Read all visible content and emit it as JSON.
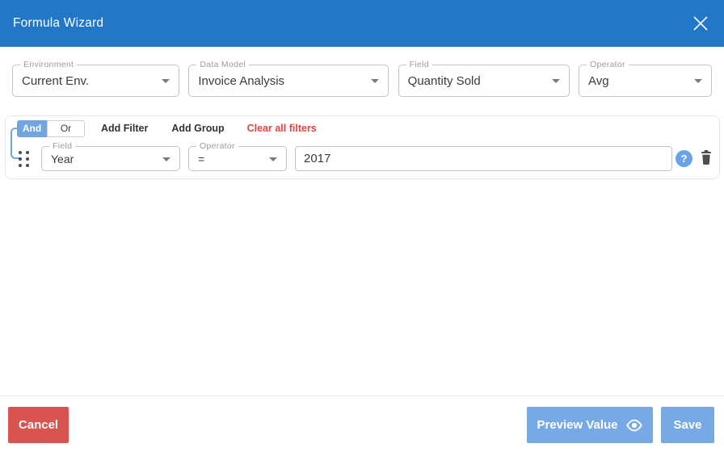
{
  "header": {
    "title": "Formula Wizard"
  },
  "selectors": {
    "environment": {
      "label": "Environment",
      "value": "Current Env."
    },
    "data_model": {
      "label": "Data Model",
      "value": "Invoice Analysis"
    },
    "field": {
      "label": "Field",
      "value": "Quantity Sold"
    },
    "operator": {
      "label": "Operator",
      "value": "Avg"
    }
  },
  "filters": {
    "and_label": "And",
    "or_label": "Or",
    "selected_logic": "And",
    "add_filter": "Add Filter",
    "add_group": "Add Group",
    "clear_all": "Clear all filters",
    "row": {
      "field_label": "Field",
      "field_value": "Year",
      "operator_label": "Operator",
      "operator_value": "=",
      "value": "2017",
      "help_glyph": "?"
    }
  },
  "footer": {
    "cancel": "Cancel",
    "preview": "Preview Value",
    "save": "Save"
  },
  "colors": {
    "header_bg": "#2277c8",
    "button_blue": "#77a9e6",
    "toggle_blue": "#70a5e0",
    "help_blue": "#6ba3e8",
    "danger_red": "#d9534f",
    "clear_red": "#e5433f"
  }
}
